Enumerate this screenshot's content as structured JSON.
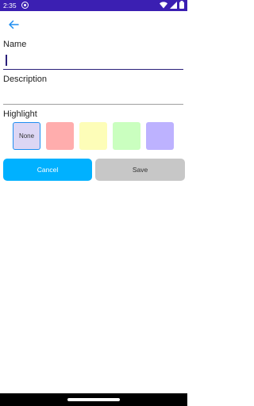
{
  "status_bar": {
    "time": "2:35",
    "app_icon": "radio-icon",
    "system_icons": [
      "wifi-icon",
      "signal-icon",
      "battery-icon"
    ]
  },
  "toolbar": {
    "back_icon": "arrow-left-icon"
  },
  "form": {
    "name_label": "Name",
    "name_value": "",
    "description_label": "Description",
    "description_value": "",
    "highlight_label": "Highlight"
  },
  "highlight_options": [
    {
      "label": "None",
      "color": "#dcd6f4",
      "selected": true
    },
    {
      "label": "",
      "color": "#ffadad",
      "selected": false
    },
    {
      "label": "",
      "color": "#fdfdb8",
      "selected": false
    },
    {
      "label": "",
      "color": "#caffbf",
      "selected": false
    },
    {
      "label": "",
      "color": "#bdb2ff",
      "selected": false
    }
  ],
  "actions": {
    "cancel_label": "Cancel",
    "save_label": "Save"
  },
  "colors": {
    "status_bar": "#3b1fb2",
    "accent": "#1f8ef1",
    "cancel_button": "#00b1ff",
    "save_button": "#c7c7c7"
  }
}
